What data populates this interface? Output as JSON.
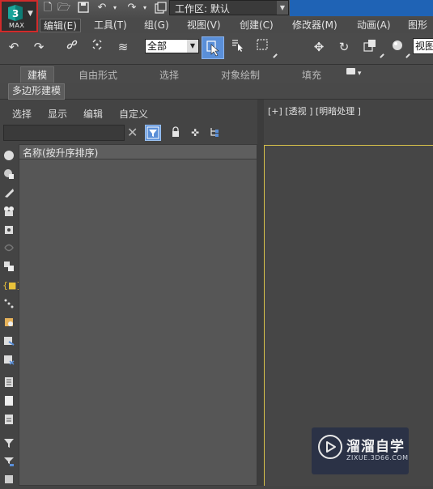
{
  "app": {
    "button_label": "MAX"
  },
  "quick_access": {
    "workspace_label": "工作区: 默认"
  },
  "menu": [
    "编辑(E)",
    "工具(T)",
    "组(G)",
    "视图(V)",
    "创建(C)",
    "修改器(M)",
    "动画(A)",
    "图形编"
  ],
  "main_toolbar": {
    "selection_filter": "全部",
    "view_dropdown": "视图"
  },
  "ribbon": {
    "tabs": [
      "建模",
      "自由形式",
      "选择",
      "对象绘制",
      "填充"
    ],
    "subtab": "多边形建模"
  },
  "scene_explorer": {
    "tabs": [
      "选择",
      "显示",
      "编辑",
      "自定义"
    ],
    "search_placeholder": "",
    "column_header": "名称(按升序排序)"
  },
  "viewport": {
    "label": "[+] [透视 ] [明暗处理 ]"
  },
  "watermark": {
    "title": "溜溜自学",
    "url": "ZIXUE.3D66.COM"
  },
  "colors": {
    "accent_blue": "#5a8fd8",
    "title_bar_blue": "#1f63b5",
    "highlight_red": "#d12b2b",
    "viewport_border": "#d8c24a"
  }
}
